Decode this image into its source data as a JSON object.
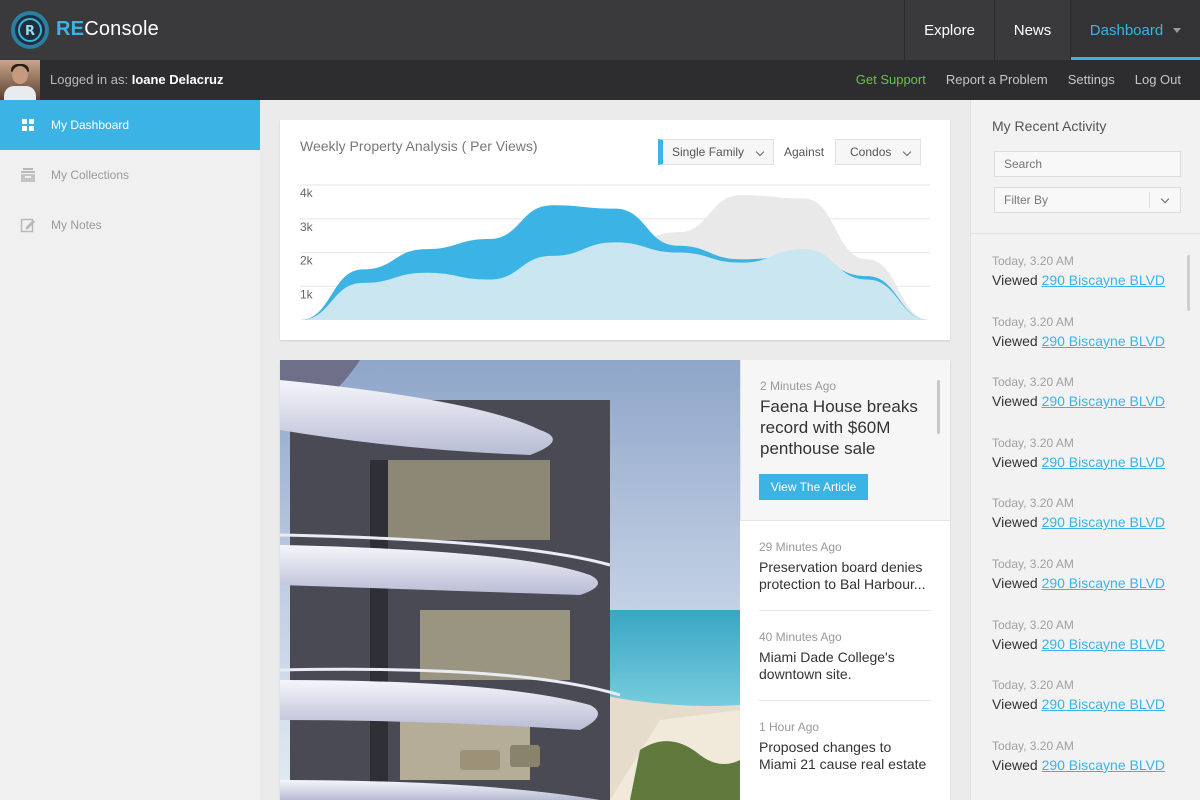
{
  "brand": {
    "prefix": "RE",
    "suffix": "Console"
  },
  "nav": {
    "explore": "Explore",
    "news": "News",
    "dashboard": "Dashboard"
  },
  "user": {
    "prefix": "Logged in as:",
    "name": "Ioane Delacruz"
  },
  "userlinks": {
    "support": "Get Support",
    "report": "Report a Problem",
    "settings": "Settings",
    "logout": "Log Out"
  },
  "sidebar": {
    "items": [
      {
        "label": "My Dashboard",
        "icon": "grid-icon"
      },
      {
        "label": "My Collections",
        "icon": "inbox-icon"
      },
      {
        "label": "My Notes",
        "icon": "edit-icon"
      }
    ]
  },
  "chart": {
    "title": "Weekly Property Analysis ( Per Views)",
    "selected_series": "Single Family",
    "against_label": "Against",
    "compare_series": "Condos"
  },
  "chart_data": {
    "type": "area",
    "y_ticks": [
      "4k",
      "3k",
      "2k",
      "1k"
    ],
    "ylim": [
      0,
      4000
    ],
    "grid": true,
    "series": [
      {
        "name": "Single Family",
        "color": "#3bb4e5",
        "values": [
          0,
          1500,
          2100,
          2400,
          3400,
          3300,
          2200,
          1800,
          1900,
          1300,
          0
        ]
      },
      {
        "name": "Condos",
        "color": "#e9e9e9",
        "values": [
          0,
          1500,
          1600,
          1500,
          2300,
          2100,
          2600,
          3700,
          3600,
          1800,
          0
        ]
      }
    ]
  },
  "news": {
    "featured": {
      "time": "2 Minutes Ago",
      "headline": "Faena House breaks record with $60M penthouse sale",
      "button": "View The Article"
    },
    "items": [
      {
        "time": "29 Minutes Ago",
        "line1": "Preservation board denies",
        "line2": "protection to Bal Harbour..."
      },
      {
        "time": "40 Minutes Ago",
        "line1": "Miami Dade College's",
        "line2": "downtown site."
      },
      {
        "time": "1 Hour Ago",
        "line1": "Proposed changes to",
        "line2": "Miami 21 cause real estate"
      }
    ]
  },
  "activity": {
    "title": "My Recent Activity",
    "search_placeholder": "Search",
    "filter_label": "Filter By",
    "items": [
      {
        "time": "Today, 3.20 AM",
        "action": "Viewed",
        "link": "290 Biscayne BLVD"
      },
      {
        "time": "Today, 3.20 AM",
        "action": "Viewed",
        "link": "290 Biscayne BLVD"
      },
      {
        "time": "Today, 3.20 AM",
        "action": "Viewed",
        "link": "290 Biscayne BLVD"
      },
      {
        "time": "Today, 3.20 AM",
        "action": "Viewed",
        "link": "290 Biscayne BLVD"
      },
      {
        "time": "Today, 3.20 AM",
        "action": "Viewed",
        "link": "290 Biscayne BLVD"
      },
      {
        "time": "Today, 3.20 AM",
        "action": "Viewed",
        "link": "290 Biscayne BLVD"
      },
      {
        "time": "Today, 3.20 AM",
        "action": "Viewed",
        "link": "290 Biscayne BLVD"
      },
      {
        "time": "Today, 3.20 AM",
        "action": "Viewed",
        "link": "290 Biscayne BLVD"
      },
      {
        "time": "Today, 3.20 AM",
        "action": "Viewed",
        "link": "290 Biscayne BLVD"
      }
    ]
  }
}
